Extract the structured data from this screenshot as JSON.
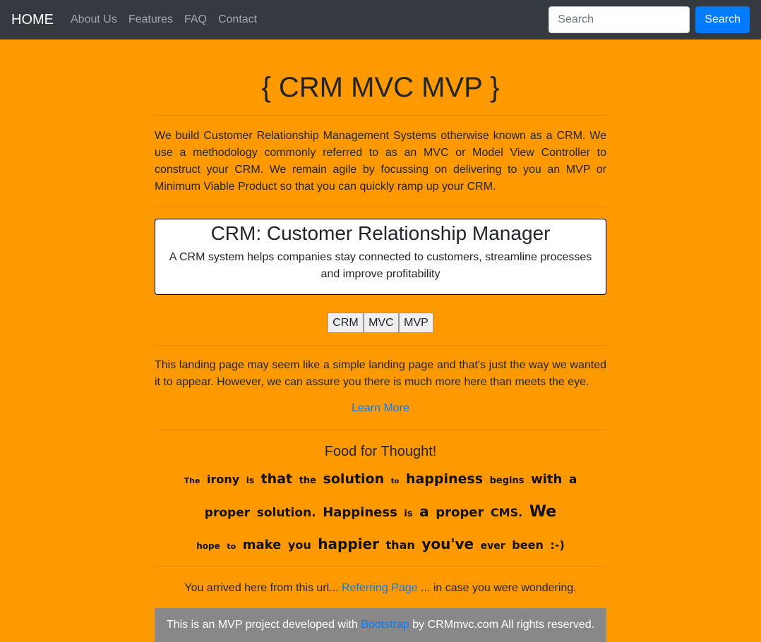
{
  "nav": {
    "brand": "HOME",
    "links": [
      "About Us",
      "Features",
      "FAQ",
      "Contact"
    ],
    "search_placeholder": "Search",
    "search_button": "Search"
  },
  "main": {
    "title": "{ CRM MVC MVP }",
    "intro": "We build Customer Relationship Management Systems otherwise known as a CRM. We use a methodology commonly referred to as an MVC or Model View Controller to construct your CRM. We remain agile by focussing on delivering to you an MVP or Minimum Viable Product so that you can quickly ramp up your CRM.",
    "card": {
      "heading": "CRM: Customer Relationship Manager",
      "text": "A CRM system helps companies stay connected to customers, streamline processes and improve profitability"
    },
    "buttons": [
      "CRM",
      "MVC",
      "MVP"
    ],
    "paragraph": "This landing page may seem like a simple landing page and that's just the way we wanted it to appear. However, we can assure you there is much more here than meets the eye.",
    "learn_more": "Learn More",
    "food_title": "Food for Thought!",
    "quote_words": [
      "The",
      "irony",
      "is",
      "that",
      "the",
      "solution",
      "to",
      "happiness",
      "begins",
      "with",
      "a",
      "proper",
      "solution.",
      "Happiness",
      "is",
      "a",
      "proper",
      "CMS.",
      "We",
      "hope",
      "to",
      "make",
      "you",
      "happier",
      "than",
      "you've",
      "ever",
      "been",
      ":-)"
    ],
    "referrer": {
      "prefix": "You arrived here from this url...",
      "link": "Referring Page",
      "suffix": "... in case you were wondering."
    },
    "footer": {
      "prefix": "This is an MVP project developed with",
      "link": "Bootstrap",
      "suffix": "by CRMmvc.com All rights reserved."
    }
  }
}
